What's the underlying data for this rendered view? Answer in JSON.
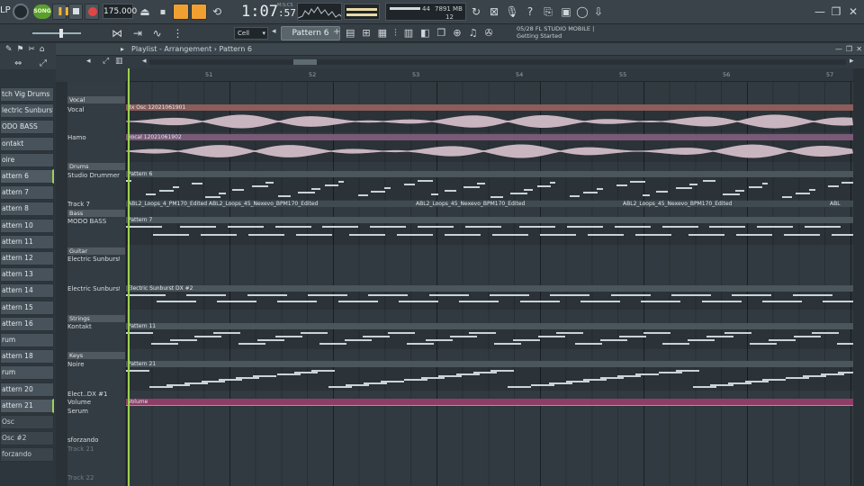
{
  "toolbar": {
    "song_label": "SONG",
    "bpm": "175.000",
    "time": "1:07",
    "time_frac": ":57",
    "time_unit": "M:S:CS",
    "mem_poly": "44",
    "mem_mb": "7891 MB",
    "mem_sub": "12",
    "cpu_icon": "cpu-graph"
  },
  "news": {
    "date": "05/28",
    "title": "FL STUDIO MOBILE |",
    "subtitle": "Getting Started"
  },
  "toolbar2": {
    "snap": "Cell",
    "pattern": "Pattern 6"
  },
  "channels": [
    "tch Vig Drums",
    "lectric Sunburst DX",
    "ODO BASS",
    "ontakt",
    "oire",
    "attern 6",
    "attern 7",
    "attern 8",
    "attern 10",
    "attern 11",
    "attern 12",
    "attern 13",
    "attern 14",
    "attern 15",
    "attern 16",
    "rum",
    "attern 18",
    "rum",
    "attern 20",
    "attern 21",
    "Osc",
    "Osc #2",
    "forzando"
  ],
  "playlist": {
    "breadcrumb": "Playlist - Arrangement › Pattern 6",
    "bars": [
      "51",
      "52",
      "53",
      "54",
      "55",
      "56",
      "57"
    ],
    "groups": {
      "vocal": "Vocal",
      "drums": "Drums",
      "bass": "Bass",
      "guitar": "Guitar",
      "strings": "Strings",
      "keys": "Keys"
    },
    "tracks": {
      "vocal": "Vocal",
      "hamo": "Hamo",
      "studio_drummer": "Studio Drummer",
      "track7": "Track 7",
      "modo_bass": "MODO BASS",
      "electric1": "Electric Sunburst DX",
      "electric2": "Electric Sunburst DX #2",
      "kontakt": "Kontakt",
      "noire": "Noire",
      "elect_auto": "Elect..DX #1",
      "volume": "Volume",
      "serum": "Serum",
      "sforzando": "sforzando",
      "track21": "Track 21",
      "track22": "Track 22"
    },
    "clips": {
      "vocal_clip": "3x Osc 12021061901",
      "hamo_clip": "vocal 12021061902",
      "pattern6": "Pattern 6",
      "loop1": "ABL2_Loops_4_PM170_Edited",
      "loop2": "ABL2_Loops_45_Nexevo_BPM170_Edited",
      "loop3": "ABL2_Loops_45_Nexevo_BPM170_Edited",
      "loop4": "ABL2_Loops_45_Nexevo_BPM170_Edited",
      "loop5": "ABL",
      "pattern7": "Pattern 7",
      "electric_clip": "Electric Sunburst DX #2",
      "pattern11": "Pattern 11",
      "pattern21": "Pattern 21",
      "volume_clip": "Volume"
    }
  },
  "colors": {
    "accent_green": "#9bd24e",
    "vocal_clip": "#8c5d5a",
    "hamo_clip": "#7a5a78",
    "volume_clip": "#8e3d67",
    "pattern_clip": "#4a555c"
  }
}
